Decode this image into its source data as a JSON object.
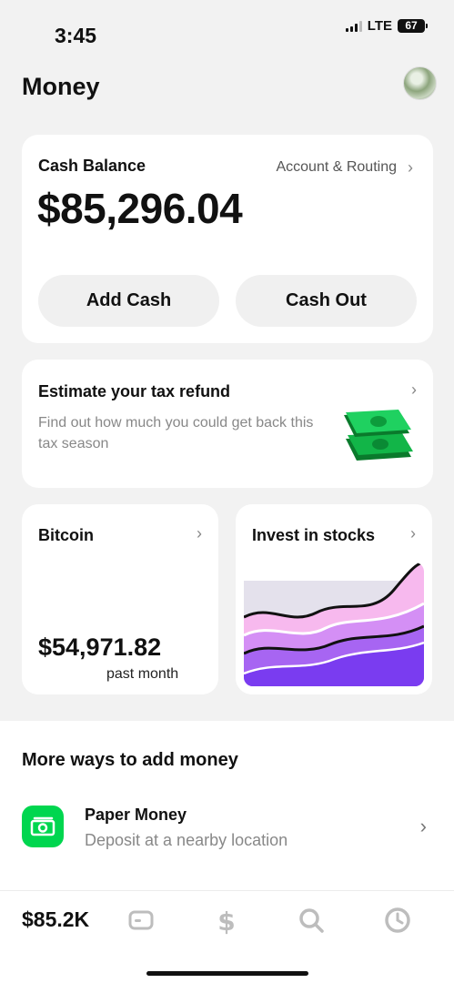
{
  "status_bar": {
    "time": "3:45",
    "network": "LTE",
    "battery": "67"
  },
  "header": {
    "title": "Money"
  },
  "balance": {
    "label": "Cash Balance",
    "account_link": "Account & Routing",
    "amount": "$85,296.04",
    "add_cash": "Add Cash",
    "cash_out": "Cash Out"
  },
  "tax": {
    "title": "Estimate your tax refund",
    "subtitle": "Find out how much you could get back this tax season"
  },
  "bitcoin": {
    "title": "Bitcoin",
    "amount": "$54,971.82",
    "period": "past month"
  },
  "stocks": {
    "title": "Invest in stocks"
  },
  "more_ways": {
    "title": "More ways to add money",
    "paper_money": {
      "title": "Paper Money",
      "subtitle": "Deposit at a nearby location"
    }
  },
  "tab_bar": {
    "balance": "$85.2K",
    "icons": [
      "card-icon",
      "dollar-icon",
      "search-icon",
      "clock-icon"
    ]
  },
  "colors": {
    "accent_green": "#00d64f",
    "background": "#f2f2f2",
    "card": "#ffffff"
  }
}
